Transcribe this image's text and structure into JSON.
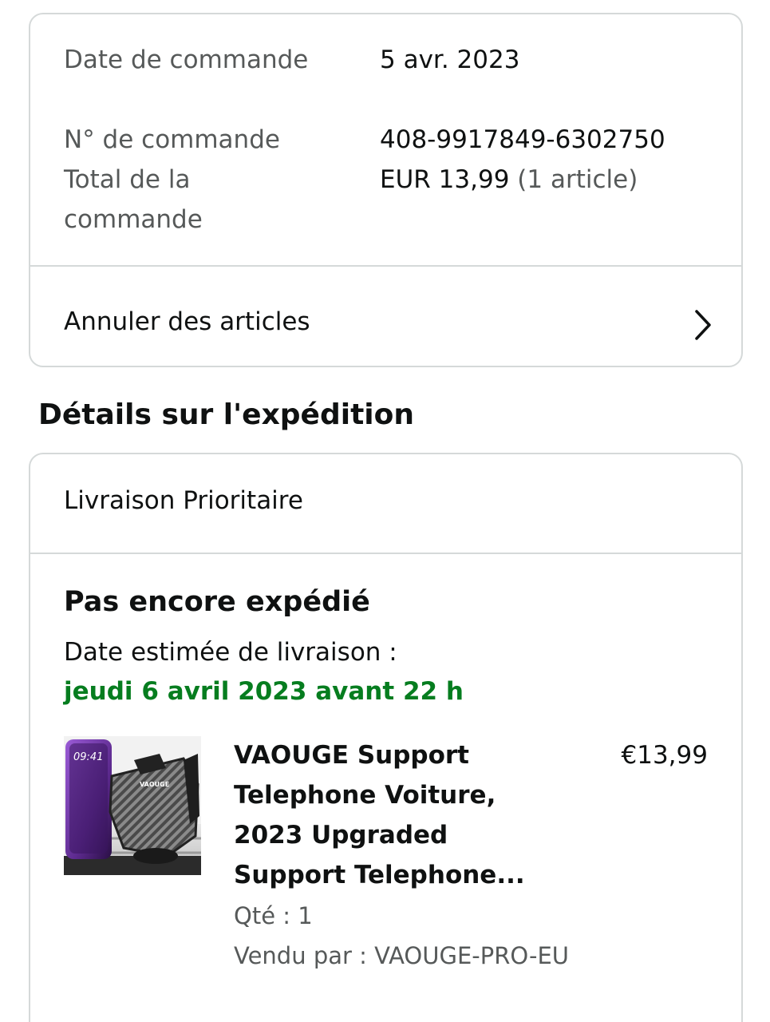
{
  "order_summary": {
    "date_label": "Date de commande",
    "date_value": "5 avr. 2023",
    "number_label": "N° de commande",
    "number_value": "408-9917849-6302750",
    "total_label": "Total de la commande",
    "total_value": "EUR 13,99",
    "total_count": "(1 article)",
    "cancel_label": "Annuler des articles"
  },
  "shipment": {
    "section_title": "Détails sur l'expédition",
    "method": "Livraison Prioritaire",
    "status": "Pas encore expédié",
    "estimate_label": "Date estimée de livraison :",
    "estimate_date": "jeudi 6 avril 2023 avant 22 h",
    "status_color": "#067d1f"
  },
  "item": {
    "title": "VAOUGE Support Telephone Voiture, 2023 Upgraded Support Telephone...",
    "price": "€13,99",
    "quantity": "Qté : 1",
    "seller": "Vendu par : VAOUGE-PRO-EU",
    "phone_time": "09:41",
    "brand_mark": "VAOUGE"
  }
}
